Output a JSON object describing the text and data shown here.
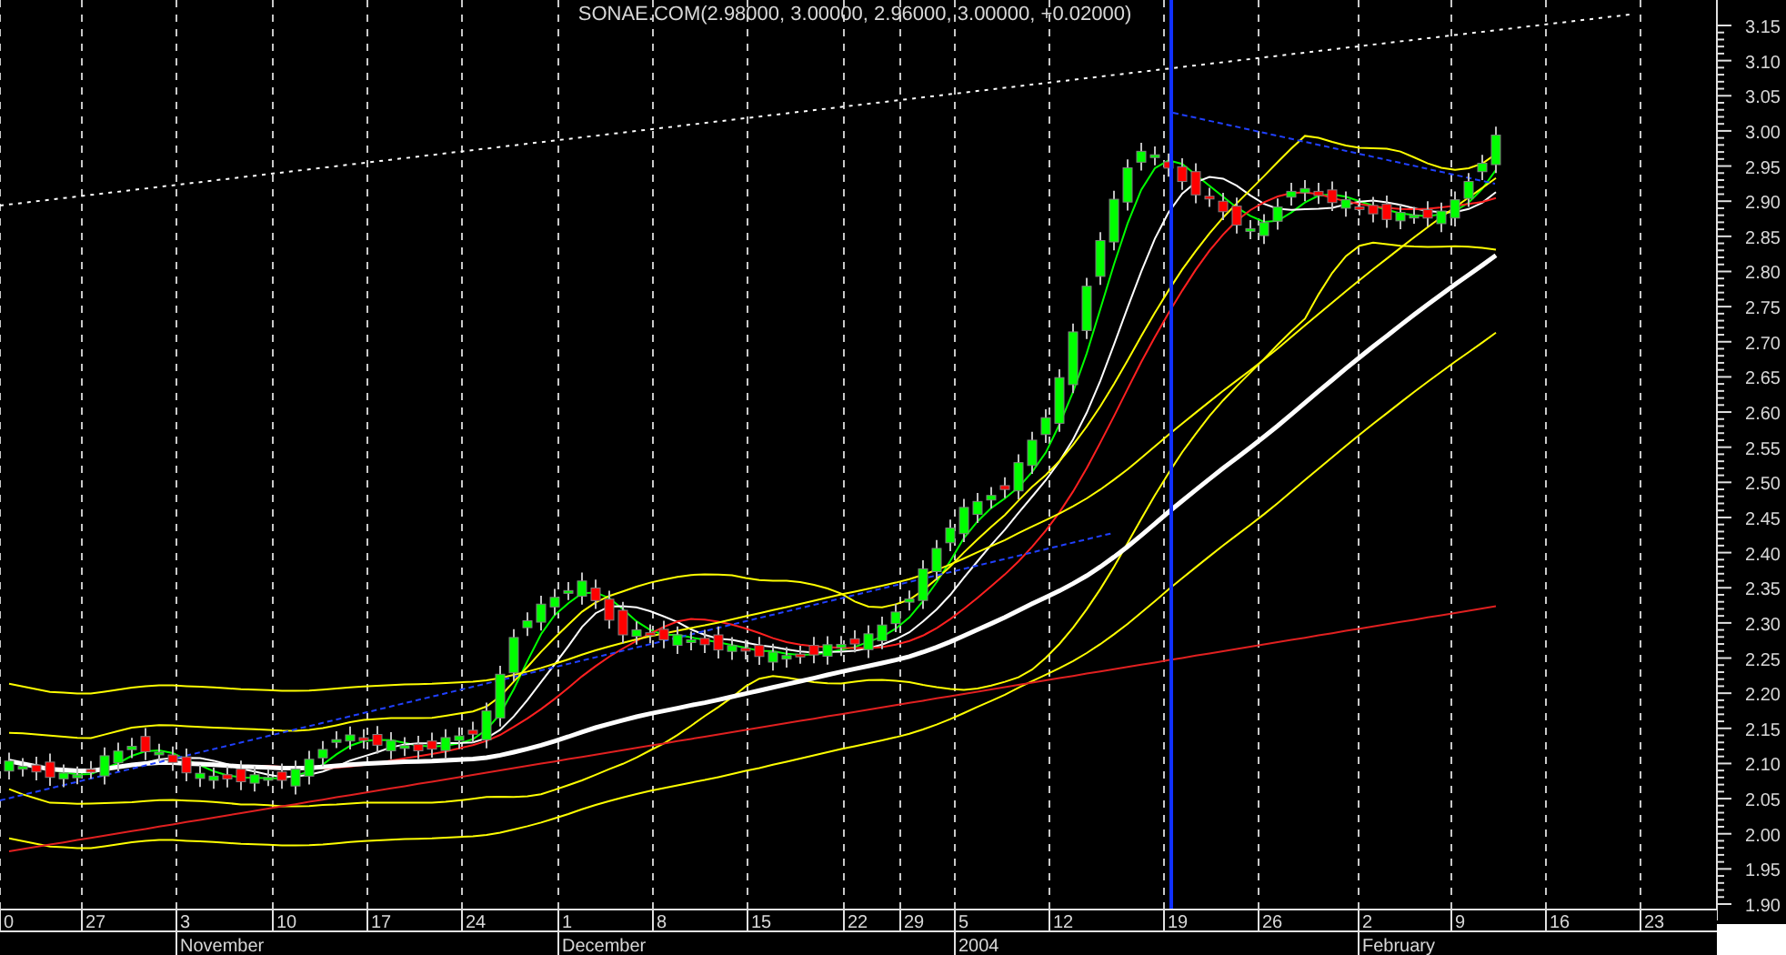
{
  "chart": {
    "title": "SONAE.COM(2.98000, 3.00000, 2.96000, 3.00000, +0.02000)",
    "price_axis": [
      "3.15",
      "3.10",
      "3.05",
      "3.00",
      "2.95",
      "2.90",
      "2.85",
      "2.80",
      "2.75",
      "2.70",
      "2.65",
      "2.60",
      "2.55",
      "2.50",
      "2.45",
      "2.40",
      "2.35",
      "2.30",
      "2.25",
      "2.20",
      "2.15",
      "2.10",
      "2.05",
      "2.00",
      "1.95",
      "1.90"
    ],
    "day_labels": [
      "0",
      "27",
      "3",
      "10",
      "17",
      "24",
      "1",
      "8",
      "15",
      "22",
      "29",
      "5",
      "12",
      "19",
      "26",
      "2",
      "9",
      "16",
      "23"
    ],
    "month_labels": [
      "November",
      "December",
      "2004",
      "February"
    ]
  }
}
